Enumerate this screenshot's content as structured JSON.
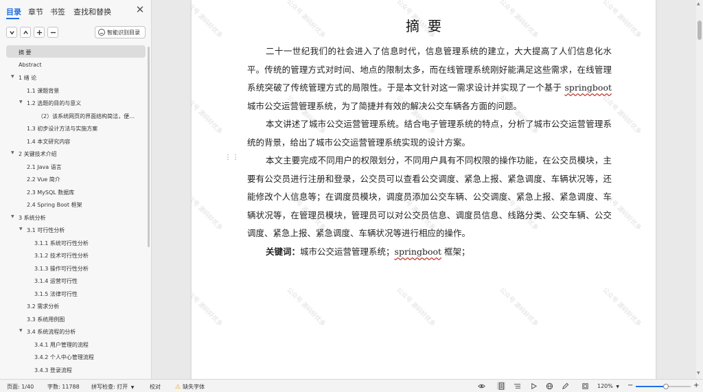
{
  "nav": {
    "tabs": [
      "目录",
      "章节",
      "书签",
      "查找和替换"
    ],
    "active_tab": "目录",
    "close_icon": "close-icon",
    "controls": [
      "chevron-down-icon",
      "chevron-up-icon",
      "plus-icon",
      "minus-icon"
    ],
    "smart_toc_label": "智能识别目录",
    "toc": [
      {
        "label": "摘  要",
        "level": 0,
        "caret": false,
        "selected": true
      },
      {
        "label": "Abstract",
        "level": 0,
        "caret": false
      },
      {
        "label": "1 绪  论",
        "level": 0,
        "caret": true
      },
      {
        "label": "1.1  课题背景",
        "level": 1,
        "caret": false
      },
      {
        "label": "1.2  选题的目的与意义",
        "level": 1,
        "caret": true
      },
      {
        "label": "（2）该系统网页的界面结构简洁，便…",
        "level": 3,
        "caret": false
      },
      {
        "label": "1.3  初步设计方法与实施方案",
        "level": 1,
        "caret": false
      },
      {
        "label": "1.4  本文研究内容",
        "level": 1,
        "caret": false
      },
      {
        "label": "2  关键技术介绍",
        "level": 0,
        "caret": true
      },
      {
        "label": "2.1 Java 语言",
        "level": 1,
        "caret": false
      },
      {
        "label": "2.2 Vue 简介",
        "level": 1,
        "caret": false
      },
      {
        "label": "2.3    MySQL 数据库",
        "level": 1,
        "caret": false
      },
      {
        "label": "2.4 Spring Boot 框架",
        "level": 1,
        "caret": false
      },
      {
        "label": "3  系统分析",
        "level": 0,
        "caret": true
      },
      {
        "label": "3.1 可行性分析",
        "level": 1,
        "caret": true
      },
      {
        "label": "3.1.1 系统可行性分析",
        "level": 2,
        "caret": false
      },
      {
        "label": "3.1.2    技术可行性分析",
        "level": 2,
        "caret": false
      },
      {
        "label": "3.1.3  操作可行性分析",
        "level": 2,
        "caret": false
      },
      {
        "label": "3.1.4 运营可行性",
        "level": 2,
        "caret": false
      },
      {
        "label": "3.1.5 法律可行性",
        "level": 2,
        "caret": false
      },
      {
        "label": "3.2  需求分析",
        "level": 1,
        "caret": false
      },
      {
        "label": "3.3 系统用例图",
        "level": 1,
        "caret": false
      },
      {
        "label": "3.4 系统流程的分析",
        "level": 1,
        "caret": true
      },
      {
        "label": "3.4.1  用户管理的流程",
        "level": 2,
        "caret": false
      },
      {
        "label": "3.4.2  个人中心管理流程",
        "level": 2,
        "caret": false
      },
      {
        "label": "3.4.3  登录流程",
        "level": 2,
        "caret": false
      }
    ]
  },
  "document": {
    "title": "摘要",
    "paragraphs": [
      "二十一世纪我们的社会进入了信息时代，信息管理系统的建立，大大提高了人们信息化水平。传统的管理方式对时间、地点的限制太多，而在线管理系统刚好能满足这些需求，在线管理系统突破了传统管理方式的局限性。于是本文针对这一需求设计并实现了一个基于 springboot 城市公交运营管理系统，为了简捷并有效的解决公交车辆各方面的问题。",
      "本文讲述了城市公交运营管理系统。结合电子管理系统的特点，分析了城市公交运营管理系统的背景，给出了城市公交运营管理系统实现的设计方案。",
      "本文主要完成不同用户的权限划分，不同用户具有不同权限的操作功能，在公交员模块，主要有公交员进行注册和登录，公交员可以查看公交调度、紧急上报、紧急调度、车辆状况等，还能修改个人信息等；在调度员模块，调度员添加公交车辆、公交调度、紧急上报、紧急调度、车辆状况等，在管理员模块，管理员可以对公交员信息、调度员信息、线路分类、公交车辆、公交调度、紧急上报、紧急调度、车辆状况等进行相应的操作。"
    ],
    "keywords_label": "关键词：",
    "keywords": "城市公交运营管理系统；springboot 框架；",
    "watermark": "公众号 源码好优多"
  },
  "status_bar": {
    "page": "页面: 1/40",
    "word_count": "字数: 11788",
    "spell_check": "拼写检查: 打开",
    "proofread": "校对",
    "missing_font": "缺失字体",
    "zoom": "120%",
    "zoom_level": 0.55,
    "icons": [
      "eye-icon",
      "page-view-icon",
      "outline-view-icon",
      "play-icon",
      "globe-icon",
      "pen-icon",
      "fit-page-icon"
    ]
  }
}
